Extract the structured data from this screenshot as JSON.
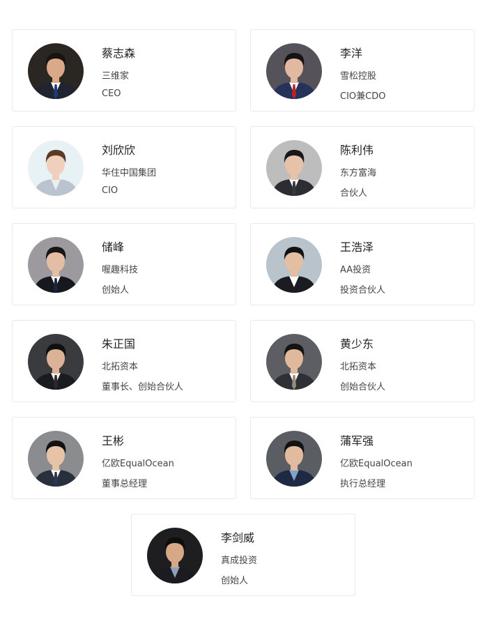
{
  "people": [
    {
      "name": "蔡志森",
      "company": "三维家",
      "title": "CEO",
      "bg": "#2a2622",
      "skin": "#d9a98a",
      "hair": "#1a1410",
      "suit": "#1f2430",
      "shirt": "#ffffff",
      "tie": "#1d3a7a"
    },
    {
      "name": "李洋",
      "company": "雪松控股",
      "title": "CIO兼CDO",
      "bg": "#55525a",
      "skin": "#e2b9a0",
      "hair": "#141414",
      "suit": "#25325a",
      "shirt": "#ffffff",
      "tie": "#c0202a"
    },
    {
      "name": "刘欣欣",
      "company": "华住中国集团",
      "title": "CIO",
      "bg": "#e8f2f4",
      "skin": "#f0d0bc",
      "hair": "#5a3a22",
      "suit": "#b9c4cf",
      "shirt": "#e9eef2",
      "tie": ""
    },
    {
      "name": "陈利伟",
      "company": "东方富海",
      "title": "合伙人",
      "bg": "#bdbdbd",
      "skin": "#e6c2a8",
      "hair": "#181818",
      "suit": "#2b2d33",
      "shirt": "#ffffff",
      "tie": "#333840"
    },
    {
      "name": "储峰",
      "company": "喔趣科技",
      "title": "创始人",
      "bg": "#9c9a9e",
      "skin": "#e3bea4",
      "hair": "#161616",
      "suit": "#16181d",
      "shirt": "#ffffff",
      "tie": "#1c2540"
    },
    {
      "name": "王浩泽",
      "company": "AA投资",
      "title": "投资合伙人",
      "bg": "#b9c3cc",
      "skin": "#e4bea0",
      "hair": "#121212",
      "suit": "#1a1c22",
      "shirt": "#ffffff",
      "tie": ""
    },
    {
      "name": "朱正国",
      "company": "北拓资本",
      "title": "董事长、创始合伙人",
      "bg": "#3a3b3f",
      "skin": "#dcb296",
      "hair": "#101010",
      "suit": "#1a1b1f",
      "shirt": "#f2f2f2",
      "tie": "#2a2a2e"
    },
    {
      "name": "黄少东",
      "company": "北拓资本",
      "title": "创始合伙人",
      "bg": "#5c5e63",
      "skin": "#e0b89c",
      "hair": "#141414",
      "suit": "#2e3036",
      "shirt": "#ffffff",
      "tie": "#9a8a7a"
    },
    {
      "name": "王彬",
      "company": "亿欧EqualOcean",
      "title": "董事总经理",
      "bg": "#8a8c90",
      "skin": "#e6c2a6",
      "hair": "#121212",
      "suit": "#2a2f3e",
      "shirt": "#ffffff",
      "tie": "#2c3550"
    },
    {
      "name": "蒲军强",
      "company": "亿欧EqualOcean",
      "title": "执行总经理",
      "bg": "#5a5d62",
      "skin": "#e2bb9e",
      "hair": "#121212",
      "suit": "#1e2a44",
      "shirt": "#7fa4c8",
      "tie": ""
    },
    {
      "name": "李剑威",
      "company": "真成投资",
      "title": "创始人",
      "bg": "#1e1e20",
      "skin": "#d7a886",
      "hair": "#0e0e0e",
      "suit": "#1c1c20",
      "shirt": "#8aa2bc",
      "tie": ""
    }
  ]
}
